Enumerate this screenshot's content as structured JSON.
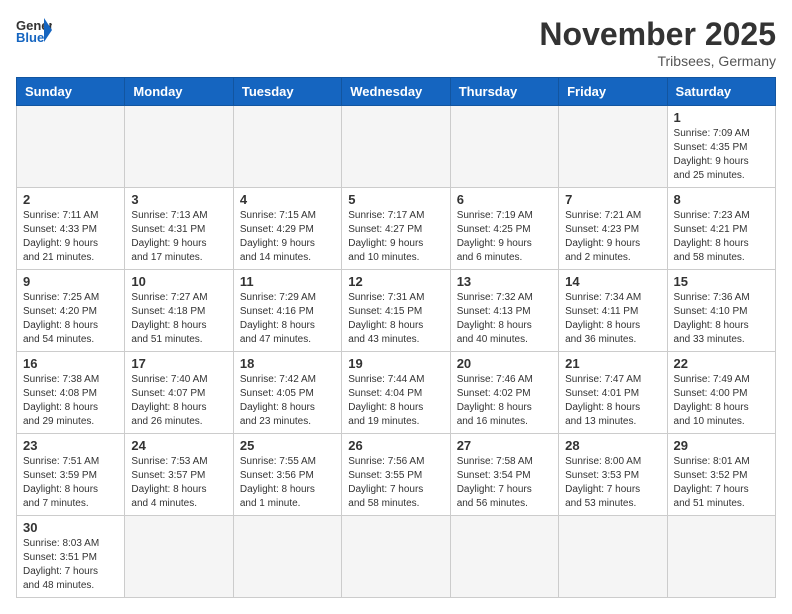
{
  "header": {
    "logo_general": "General",
    "logo_blue": "Blue",
    "month": "November 2025",
    "location": "Tribsees, Germany"
  },
  "weekdays": [
    "Sunday",
    "Monday",
    "Tuesday",
    "Wednesday",
    "Thursday",
    "Friday",
    "Saturday"
  ],
  "weeks": [
    [
      {
        "day": "",
        "info": ""
      },
      {
        "day": "",
        "info": ""
      },
      {
        "day": "",
        "info": ""
      },
      {
        "day": "",
        "info": ""
      },
      {
        "day": "",
        "info": ""
      },
      {
        "day": "",
        "info": ""
      },
      {
        "day": "1",
        "info": "Sunrise: 7:09 AM\nSunset: 4:35 PM\nDaylight: 9 hours\nand 25 minutes."
      }
    ],
    [
      {
        "day": "2",
        "info": "Sunrise: 7:11 AM\nSunset: 4:33 PM\nDaylight: 9 hours\nand 21 minutes."
      },
      {
        "day": "3",
        "info": "Sunrise: 7:13 AM\nSunset: 4:31 PM\nDaylight: 9 hours\nand 17 minutes."
      },
      {
        "day": "4",
        "info": "Sunrise: 7:15 AM\nSunset: 4:29 PM\nDaylight: 9 hours\nand 14 minutes."
      },
      {
        "day": "5",
        "info": "Sunrise: 7:17 AM\nSunset: 4:27 PM\nDaylight: 9 hours\nand 10 minutes."
      },
      {
        "day": "6",
        "info": "Sunrise: 7:19 AM\nSunset: 4:25 PM\nDaylight: 9 hours\nand 6 minutes."
      },
      {
        "day": "7",
        "info": "Sunrise: 7:21 AM\nSunset: 4:23 PM\nDaylight: 9 hours\nand 2 minutes."
      },
      {
        "day": "8",
        "info": "Sunrise: 7:23 AM\nSunset: 4:21 PM\nDaylight: 8 hours\nand 58 minutes."
      }
    ],
    [
      {
        "day": "9",
        "info": "Sunrise: 7:25 AM\nSunset: 4:20 PM\nDaylight: 8 hours\nand 54 minutes."
      },
      {
        "day": "10",
        "info": "Sunrise: 7:27 AM\nSunset: 4:18 PM\nDaylight: 8 hours\nand 51 minutes."
      },
      {
        "day": "11",
        "info": "Sunrise: 7:29 AM\nSunset: 4:16 PM\nDaylight: 8 hours\nand 47 minutes."
      },
      {
        "day": "12",
        "info": "Sunrise: 7:31 AM\nSunset: 4:15 PM\nDaylight: 8 hours\nand 43 minutes."
      },
      {
        "day": "13",
        "info": "Sunrise: 7:32 AM\nSunset: 4:13 PM\nDaylight: 8 hours\nand 40 minutes."
      },
      {
        "day": "14",
        "info": "Sunrise: 7:34 AM\nSunset: 4:11 PM\nDaylight: 8 hours\nand 36 minutes."
      },
      {
        "day": "15",
        "info": "Sunrise: 7:36 AM\nSunset: 4:10 PM\nDaylight: 8 hours\nand 33 minutes."
      }
    ],
    [
      {
        "day": "16",
        "info": "Sunrise: 7:38 AM\nSunset: 4:08 PM\nDaylight: 8 hours\nand 29 minutes."
      },
      {
        "day": "17",
        "info": "Sunrise: 7:40 AM\nSunset: 4:07 PM\nDaylight: 8 hours\nand 26 minutes."
      },
      {
        "day": "18",
        "info": "Sunrise: 7:42 AM\nSunset: 4:05 PM\nDaylight: 8 hours\nand 23 minutes."
      },
      {
        "day": "19",
        "info": "Sunrise: 7:44 AM\nSunset: 4:04 PM\nDaylight: 8 hours\nand 19 minutes."
      },
      {
        "day": "20",
        "info": "Sunrise: 7:46 AM\nSunset: 4:02 PM\nDaylight: 8 hours\nand 16 minutes."
      },
      {
        "day": "21",
        "info": "Sunrise: 7:47 AM\nSunset: 4:01 PM\nDaylight: 8 hours\nand 13 minutes."
      },
      {
        "day": "22",
        "info": "Sunrise: 7:49 AM\nSunset: 4:00 PM\nDaylight: 8 hours\nand 10 minutes."
      }
    ],
    [
      {
        "day": "23",
        "info": "Sunrise: 7:51 AM\nSunset: 3:59 PM\nDaylight: 8 hours\nand 7 minutes."
      },
      {
        "day": "24",
        "info": "Sunrise: 7:53 AM\nSunset: 3:57 PM\nDaylight: 8 hours\nand 4 minutes."
      },
      {
        "day": "25",
        "info": "Sunrise: 7:55 AM\nSunset: 3:56 PM\nDaylight: 8 hours\nand 1 minute."
      },
      {
        "day": "26",
        "info": "Sunrise: 7:56 AM\nSunset: 3:55 PM\nDaylight: 7 hours\nand 58 minutes."
      },
      {
        "day": "27",
        "info": "Sunrise: 7:58 AM\nSunset: 3:54 PM\nDaylight: 7 hours\nand 56 minutes."
      },
      {
        "day": "28",
        "info": "Sunrise: 8:00 AM\nSunset: 3:53 PM\nDaylight: 7 hours\nand 53 minutes."
      },
      {
        "day": "29",
        "info": "Sunrise: 8:01 AM\nSunset: 3:52 PM\nDaylight: 7 hours\nand 51 minutes."
      }
    ],
    [
      {
        "day": "30",
        "info": "Sunrise: 8:03 AM\nSunset: 3:51 PM\nDaylight: 7 hours\nand 48 minutes."
      },
      {
        "day": "",
        "info": ""
      },
      {
        "day": "",
        "info": ""
      },
      {
        "day": "",
        "info": ""
      },
      {
        "day": "",
        "info": ""
      },
      {
        "day": "",
        "info": ""
      },
      {
        "day": "",
        "info": ""
      }
    ]
  ]
}
